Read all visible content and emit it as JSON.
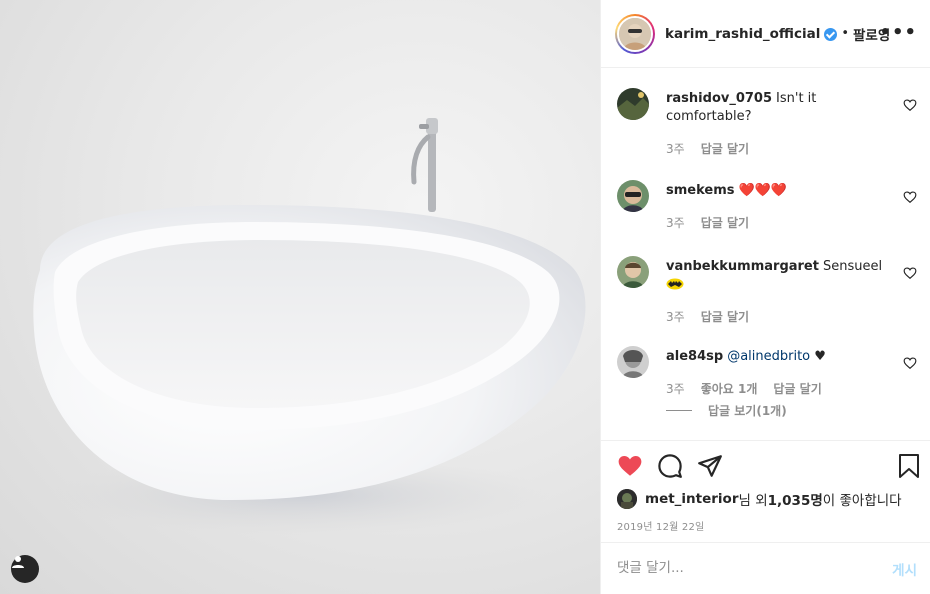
{
  "post": {
    "image_alt": "white freestanding bathtub",
    "author": "karim_rashid_official",
    "verified": true,
    "separator": "•",
    "follow_label": "팔로잉",
    "more_label": "•••"
  },
  "comments": [
    {
      "user": "rashidov_0705",
      "text": "Isn't it comfortable?",
      "time": "3주",
      "likes": "",
      "reply": "답글 달기"
    },
    {
      "user": "smekems",
      "text": "❤️❤️❤️",
      "time": "3주",
      "likes": "",
      "reply": "답글 달기"
    },
    {
      "user": "vanbekkummargaret",
      "text": "Sensueel",
      "time": "3주",
      "likes": "",
      "reply": "답글 달기"
    },
    {
      "user": "ale84sp",
      "mention": "@alinedbrito",
      "text": "♥",
      "time": "3주",
      "likes": "좋아요 1개",
      "reply": "답글 달기",
      "view_replies": "답글 보기(1개)"
    }
  ],
  "actions": {
    "liked_by_user": "met_interior",
    "likes_text_1": "님 외 ",
    "likes_count": "1,035명",
    "likes_text_2": "이 좋아합니다",
    "date": "2019년 12월 22일",
    "like_color": "#ed4956"
  },
  "comment_box": {
    "placeholder": "댓글 달기...",
    "post_label": "게시"
  },
  "colors": {
    "verified": "#3897f0",
    "mention": "#00376b",
    "post_disabled": "#b2dffc"
  }
}
